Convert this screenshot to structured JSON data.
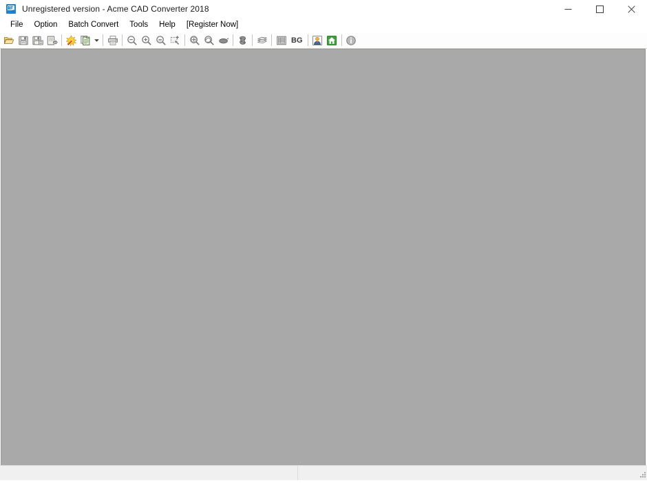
{
  "window": {
    "title": "Unregistered version - Acme CAD Converter 2018",
    "icon": "app-icon",
    "controls": {
      "minimize_label": "Minimize",
      "maximize_label": "Maximize",
      "close_label": "Close"
    }
  },
  "menu": {
    "items": [
      {
        "label": "File",
        "name": "menu-file"
      },
      {
        "label": "Option",
        "name": "menu-option"
      },
      {
        "label": "Batch Convert",
        "name": "menu-batch-convert"
      },
      {
        "label": "Tools",
        "name": "menu-tools"
      },
      {
        "label": "Help",
        "name": "menu-help"
      },
      {
        "label": "[Register Now]",
        "name": "menu-register-now"
      }
    ]
  },
  "toolbar": {
    "buttons": [
      {
        "name": "open-file-icon",
        "tooltip": "Open"
      },
      {
        "name": "save-icon",
        "tooltip": "Save"
      },
      {
        "name": "save-as-icon",
        "tooltip": "Save As"
      },
      {
        "name": "export-icon",
        "tooltip": "Export"
      },
      {
        "name": "convert-icon",
        "tooltip": "Convert"
      },
      {
        "name": "batch-convert-icon",
        "tooltip": "Batch Convert"
      },
      {
        "name": "batch-convert-dropdown-icon",
        "tooltip": "Batch Convert Options"
      },
      {
        "name": "print-icon",
        "tooltip": "Print"
      },
      {
        "name": "zoom-out-icon",
        "tooltip": "Zoom Out"
      },
      {
        "name": "zoom-in-icon",
        "tooltip": "Zoom In"
      },
      {
        "name": "zoom-reset-icon",
        "tooltip": "Zoom 1:1"
      },
      {
        "name": "zoom-window-icon",
        "tooltip": "Zoom Window"
      },
      {
        "name": "zoom-extents-icon",
        "tooltip": "Zoom Extents"
      },
      {
        "name": "zoom-previous-icon",
        "tooltip": "Zoom Previous"
      },
      {
        "name": "pan-icon",
        "tooltip": "Pan"
      },
      {
        "name": "measure-icon",
        "tooltip": "Measure"
      },
      {
        "name": "layers-icon",
        "tooltip": "Layers"
      },
      {
        "name": "properties-icon",
        "tooltip": "Properties"
      },
      {
        "name": "background-color-button",
        "label": "BG",
        "tooltip": "Background Color"
      },
      {
        "name": "user-icon",
        "tooltip": "User"
      },
      {
        "name": "home-icon",
        "tooltip": "Home"
      },
      {
        "name": "info-icon",
        "tooltip": "About"
      }
    ],
    "bg_label": "BG"
  },
  "statusbar": {
    "pane_left": "",
    "pane_right": ""
  },
  "colors": {
    "client_background": "#a9a9a9",
    "titlebar_background": "#ffffff",
    "toolbar_background": "#fdfdfd",
    "statusbar_background": "#f0f0f0",
    "accent_blue": "#1a84d6",
    "accent_yellow": "#f2c13c",
    "accent_red": "#e8402a",
    "accent_green": "#41a03c"
  }
}
